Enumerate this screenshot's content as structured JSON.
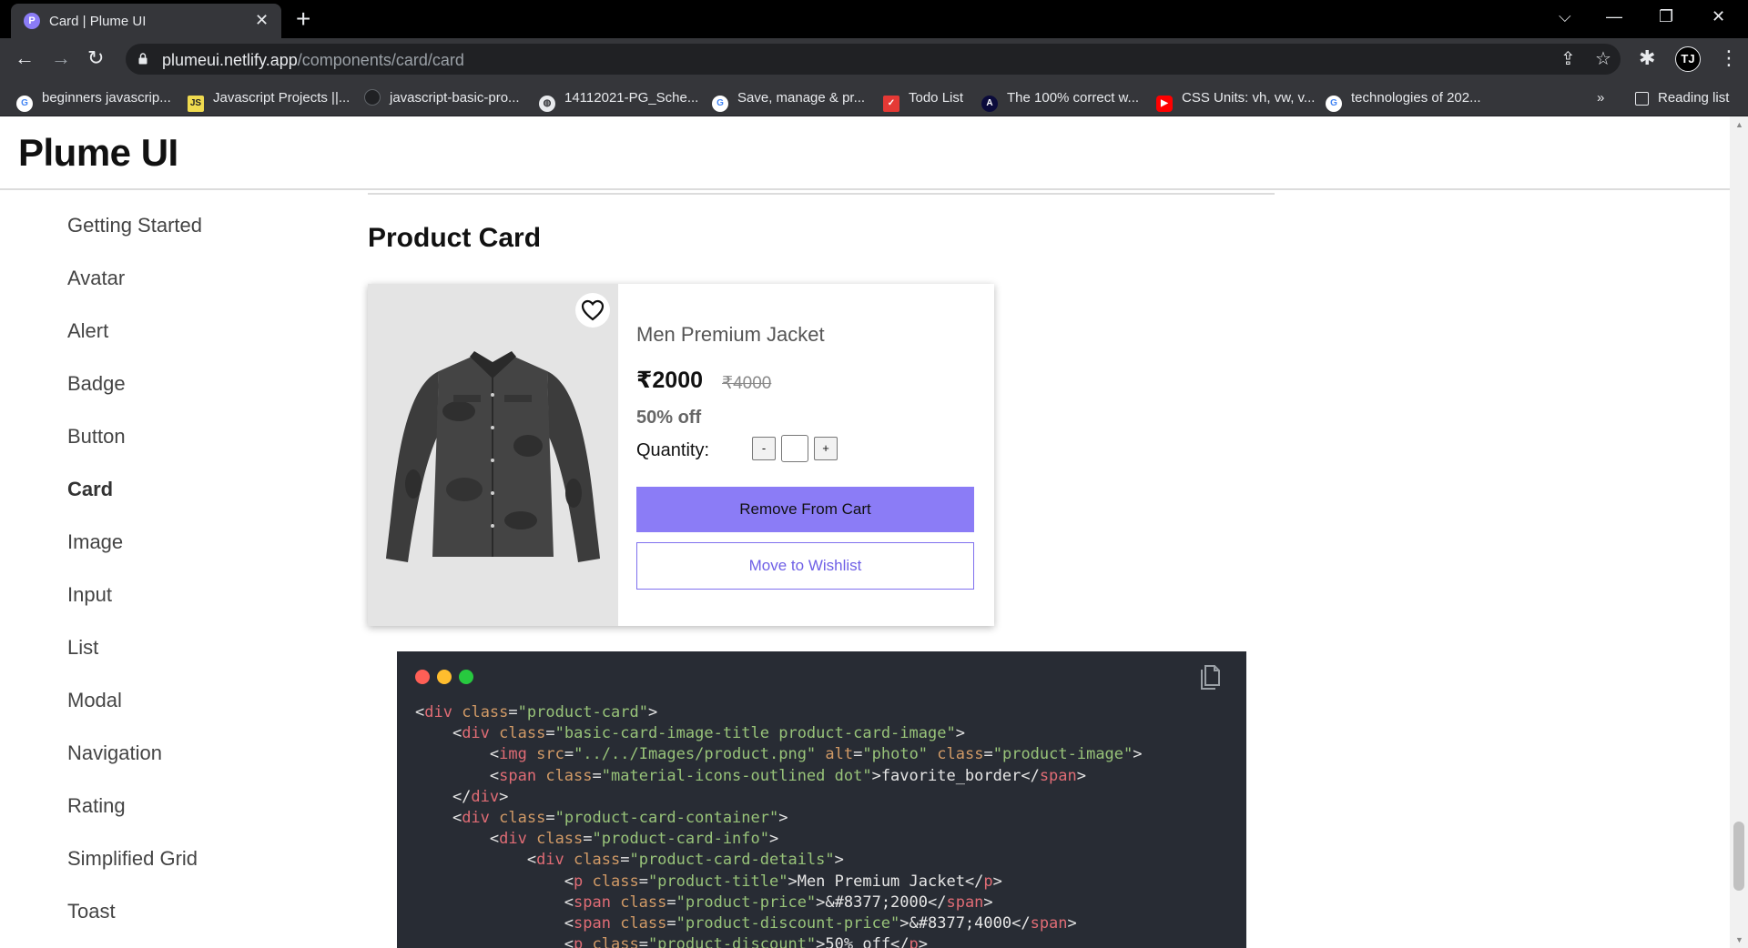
{
  "browser": {
    "tab": {
      "title": "Card | Plume UI",
      "favicon_letter": "P",
      "close": "✕"
    },
    "new_tab": "+",
    "window_controls": {
      "dropdown": "⌵",
      "minimize": "—",
      "restore": "❐",
      "close": "✕"
    },
    "address": {
      "host": "plumeui.netlify.app",
      "path": "/components/card/card"
    },
    "profile_initials": "TJ",
    "bookmarks": [
      {
        "label": "beginners javascrip...",
        "icon": "google-icon"
      },
      {
        "label": "Javascript Projects ||...",
        "icon": "js-icon",
        "icon_text": "JS"
      },
      {
        "label": "javascript-basic-pro...",
        "icon": "github-icon"
      },
      {
        "label": "14112021-PG_Sche...",
        "icon": "globe-icon"
      },
      {
        "label": "Save, manage & pr...",
        "icon": "google-icon"
      },
      {
        "label": "Todo List",
        "icon": "todo-icon"
      },
      {
        "label": "The 100% correct w...",
        "icon": "angular-icon",
        "icon_text": "A"
      },
      {
        "label": "CSS Units: vh, vw, v...",
        "icon": "youtube-icon"
      },
      {
        "label": "technologies of 202...",
        "icon": "google-icon"
      }
    ],
    "bookmarks_overflow": "»",
    "reading_list": "Reading list"
  },
  "site": {
    "logo": "Plume UI",
    "sidebar": [
      {
        "label": "Getting Started",
        "active": false
      },
      {
        "label": "Avatar",
        "active": false
      },
      {
        "label": "Alert",
        "active": false
      },
      {
        "label": "Badge",
        "active": false
      },
      {
        "label": "Button",
        "active": false
      },
      {
        "label": "Card",
        "active": true
      },
      {
        "label": "Image",
        "active": false
      },
      {
        "label": "Input",
        "active": false
      },
      {
        "label": "List",
        "active": false
      },
      {
        "label": "Modal",
        "active": false
      },
      {
        "label": "Navigation",
        "active": false
      },
      {
        "label": "Rating",
        "active": false
      },
      {
        "label": "Simplified Grid",
        "active": false
      },
      {
        "label": "Toast",
        "active": false
      }
    ],
    "section_title": "Product Card",
    "product_card": {
      "title": "Men Premium Jacket",
      "price": "₹2000",
      "old_price": "₹4000",
      "discount": "50% off",
      "quantity_label": "Quantity:",
      "quantity_minus": "-",
      "quantity_plus": "+",
      "quantity_value": "",
      "remove_button": "Remove From Cart",
      "wishlist_button": "Move to Wishlist"
    },
    "code_lines": [
      [
        [
          "p",
          "<"
        ],
        [
          "t",
          "div"
        ],
        [
          "p",
          " "
        ],
        [
          "a",
          "class"
        ],
        [
          "p",
          "="
        ],
        [
          "s",
          "\"product-card\""
        ],
        [
          "p",
          ">"
        ]
      ],
      [
        [
          "p",
          "    <"
        ],
        [
          "t",
          "div"
        ],
        [
          "p",
          " "
        ],
        [
          "a",
          "class"
        ],
        [
          "p",
          "="
        ],
        [
          "s",
          "\"basic-card-image-title product-card-image\""
        ],
        [
          "p",
          ">"
        ]
      ],
      [
        [
          "p",
          "        <"
        ],
        [
          "t",
          "img"
        ],
        [
          "p",
          " "
        ],
        [
          "a",
          "src"
        ],
        [
          "p",
          "="
        ],
        [
          "s",
          "\"../../Images/product.png\""
        ],
        [
          "p",
          " "
        ],
        [
          "a",
          "alt"
        ],
        [
          "p",
          "="
        ],
        [
          "s",
          "\"photo\""
        ],
        [
          "p",
          " "
        ],
        [
          "a",
          "class"
        ],
        [
          "p",
          "="
        ],
        [
          "s",
          "\"product-image\""
        ],
        [
          "p",
          ">"
        ]
      ],
      [
        [
          "p",
          "        <"
        ],
        [
          "t",
          "span"
        ],
        [
          "p",
          " "
        ],
        [
          "a",
          "class"
        ],
        [
          "p",
          "="
        ],
        [
          "s",
          "\"material-icons-outlined dot\""
        ],
        [
          "p",
          ">favorite_border</"
        ],
        [
          "t",
          "span"
        ],
        [
          "p",
          ">"
        ]
      ],
      [
        [
          "p",
          "    </"
        ],
        [
          "t",
          "div"
        ],
        [
          "p",
          ">"
        ]
      ],
      [
        [
          "p",
          "    <"
        ],
        [
          "t",
          "div"
        ],
        [
          "p",
          " "
        ],
        [
          "a",
          "class"
        ],
        [
          "p",
          "="
        ],
        [
          "s",
          "\"product-card-container\""
        ],
        [
          "p",
          ">"
        ]
      ],
      [
        [
          "p",
          "        <"
        ],
        [
          "t",
          "div"
        ],
        [
          "p",
          " "
        ],
        [
          "a",
          "class"
        ],
        [
          "p",
          "="
        ],
        [
          "s",
          "\"product-card-info\""
        ],
        [
          "p",
          ">"
        ]
      ],
      [
        [
          "p",
          "            <"
        ],
        [
          "t",
          "div"
        ],
        [
          "p",
          " "
        ],
        [
          "a",
          "class"
        ],
        [
          "p",
          "="
        ],
        [
          "s",
          "\"product-card-details\""
        ],
        [
          "p",
          ">"
        ]
      ],
      [
        [
          "p",
          "                <"
        ],
        [
          "t",
          "p"
        ],
        [
          "p",
          " "
        ],
        [
          "a",
          "class"
        ],
        [
          "p",
          "="
        ],
        [
          "s",
          "\"product-title\""
        ],
        [
          "p",
          ">Men Premium Jacket</"
        ],
        [
          "t",
          "p"
        ],
        [
          "p",
          ">"
        ]
      ],
      [
        [
          "p",
          "                <"
        ],
        [
          "t",
          "span"
        ],
        [
          "p",
          " "
        ],
        [
          "a",
          "class"
        ],
        [
          "p",
          "="
        ],
        [
          "s",
          "\"product-price\""
        ],
        [
          "p",
          ">&#8377;2000</"
        ],
        [
          "t",
          "span"
        ],
        [
          "p",
          ">"
        ]
      ],
      [
        [
          "p",
          "                <"
        ],
        [
          "t",
          "span"
        ],
        [
          "p",
          " "
        ],
        [
          "a",
          "class"
        ],
        [
          "p",
          "="
        ],
        [
          "s",
          "\"product-discount-price\""
        ],
        [
          "p",
          ">&#8377;4000</"
        ],
        [
          "t",
          "span"
        ],
        [
          "p",
          ">"
        ]
      ],
      [
        [
          "p",
          "                <"
        ],
        [
          "t",
          "p"
        ],
        [
          "p",
          " "
        ],
        [
          "a",
          "class"
        ],
        [
          "p",
          "="
        ],
        [
          "s",
          "\"product-discount\""
        ],
        [
          "p",
          ">50% off</"
        ],
        [
          "t",
          "p"
        ],
        [
          "p",
          ">"
        ]
      ]
    ]
  },
  "colors": {
    "accent": "#8b7cf6",
    "accent_text": "#6f60e6",
    "code_bg": "#282c34",
    "mac_red": "#ff5f56",
    "mac_yellow": "#ffbd2e",
    "mac_green": "#27c93f"
  }
}
